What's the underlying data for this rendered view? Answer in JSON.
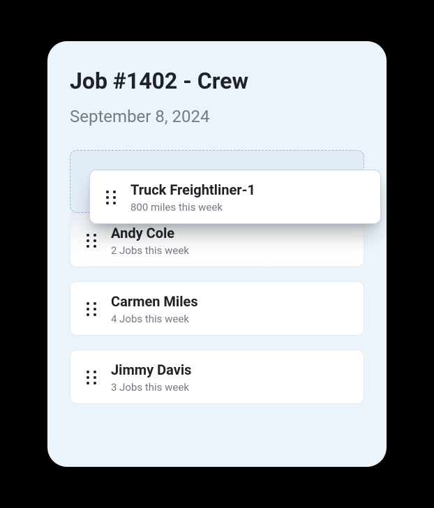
{
  "header": {
    "title": "Job #1402 - Crew",
    "date": "September 8, 2024"
  },
  "items": {
    "floating": {
      "name": "Truck Freightliner-1",
      "subtitle": "800 miles this week"
    },
    "list": [
      {
        "name": "Andy Cole",
        "subtitle": "2 Jobs this week"
      },
      {
        "name": "Carmen Miles",
        "subtitle": "4 Jobs this week"
      },
      {
        "name": "Jimmy Davis",
        "subtitle": "3 Jobs this week"
      }
    ]
  }
}
